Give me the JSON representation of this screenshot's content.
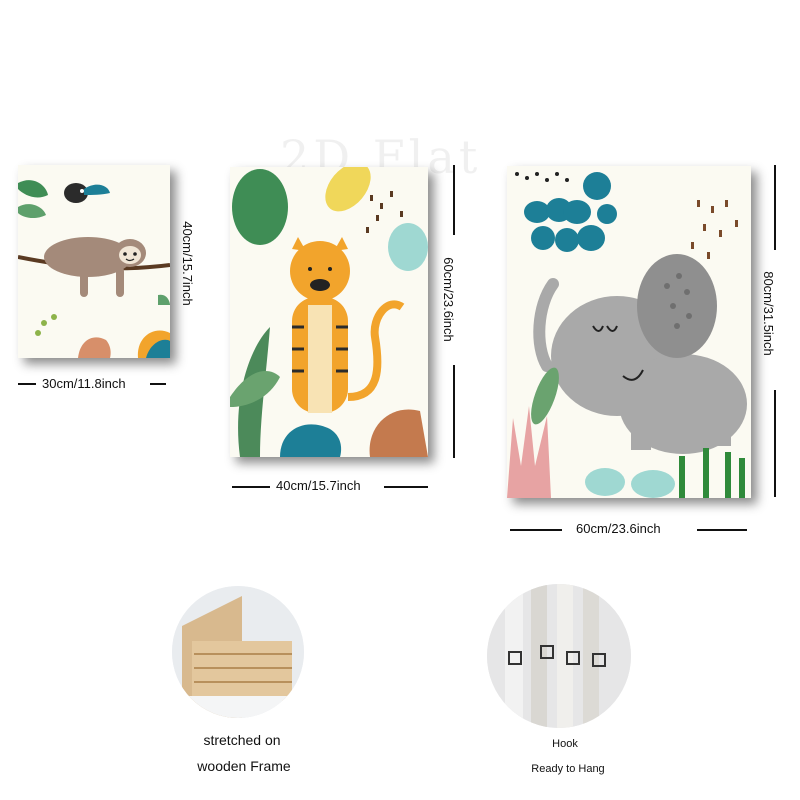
{
  "watermark": "2D Flat",
  "panels": [
    {
      "id": "sloth",
      "width_label": "30cm/11.8inch",
      "height_label": "40cm/15.7inch"
    },
    {
      "id": "tiger",
      "width_label": "40cm/15.7inch",
      "height_label": "60cm/23.6inch"
    },
    {
      "id": "elephant",
      "width_label": "60cm/23.6inch",
      "height_label": "80cm/31.5inch"
    }
  ],
  "features": [
    {
      "id": "frame",
      "caption_line1": "stretched on",
      "caption_line2": "wooden Frame"
    },
    {
      "id": "hook",
      "caption_line1": "Hook",
      "caption_line2": "Ready to Hang"
    }
  ],
  "colors": {
    "teal": "#1d7f97",
    "leaf_green": "#3f8d55",
    "orange": "#f2a42c",
    "grey": "#a9a9a9",
    "pink": "#e7a3a3",
    "brown": "#7a4a2b"
  }
}
